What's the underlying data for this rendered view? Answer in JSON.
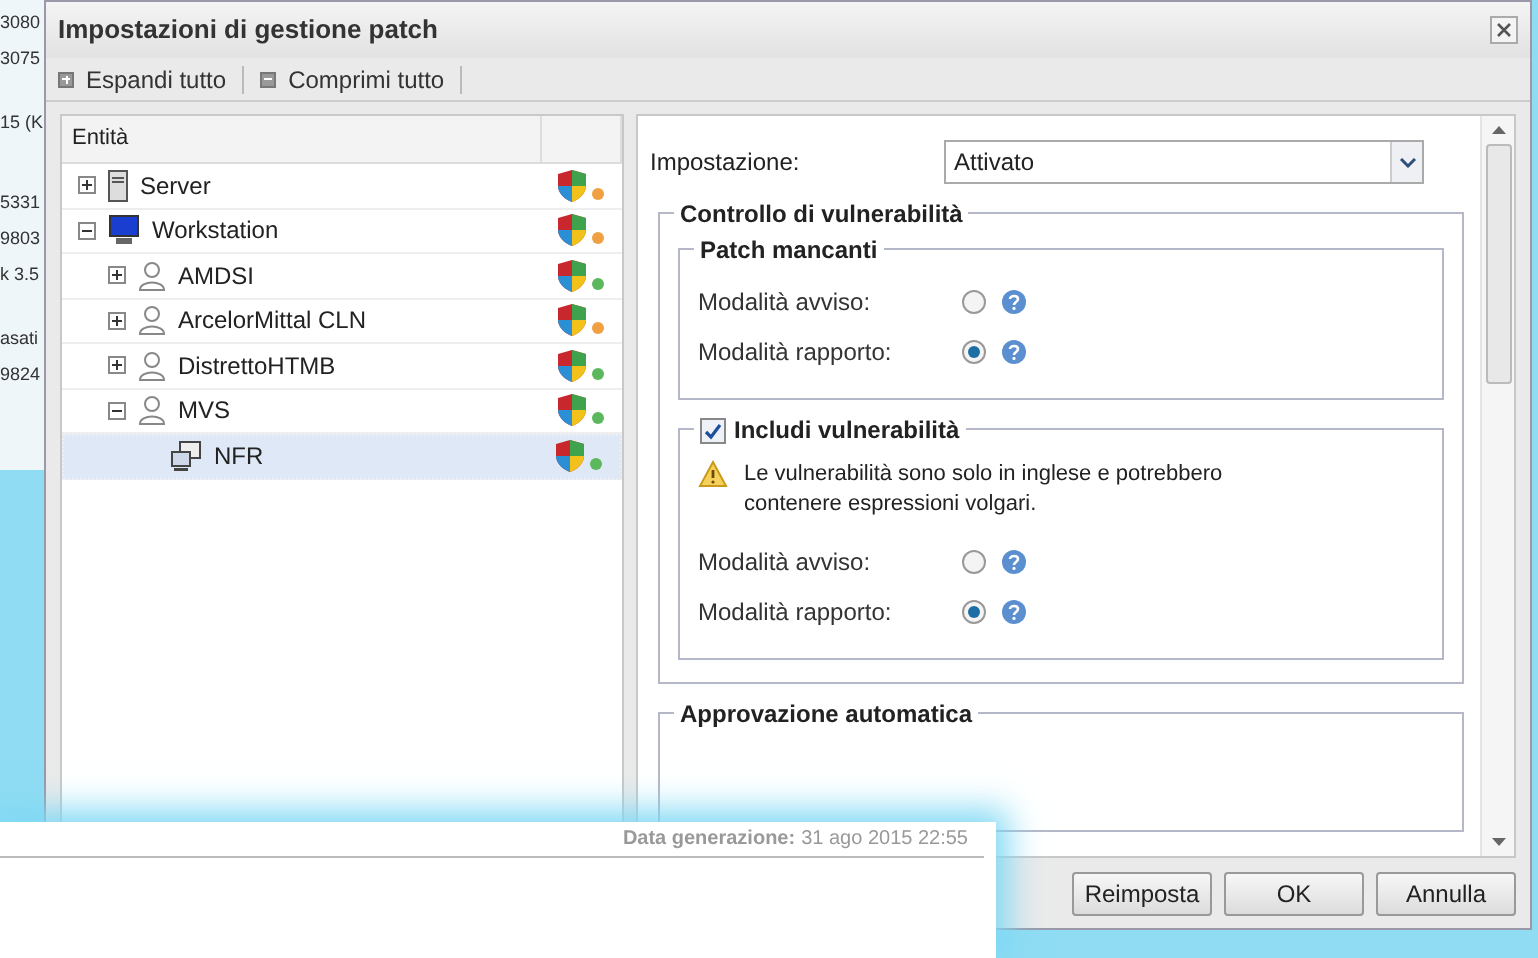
{
  "background_page": {
    "fragments": [
      "3080",
      "3075",
      "15 (K",
      "5331",
      "9803",
      "k 3.5",
      "asati",
      "9824"
    ]
  },
  "window": {
    "title": "Impostazioni di gestione patch"
  },
  "toolbar": [
    {
      "kind": "expand",
      "label": "Espandi tutto"
    },
    {
      "kind": "collapse",
      "label": "Comprimi tutto"
    }
  ],
  "tree": {
    "column": "Entità",
    "items": [
      {
        "label": "Server",
        "kind": "server",
        "expanded": false,
        "selected": false,
        "color": "#f0a040"
      },
      {
        "label": "Workstation",
        "kind": "workstation",
        "expanded": true,
        "selected": false,
        "color": "#f0a040",
        "children": [
          {
            "label": "AMDSI",
            "kind": "user",
            "expanded": false,
            "selected": false,
            "color": "#5cb85c"
          },
          {
            "label": "ArcelorMittal CLN",
            "kind": "user",
            "expanded": false,
            "selected": false,
            "color": "#f0a040"
          },
          {
            "label": "DistrettoHTMB",
            "kind": "user",
            "expanded": false,
            "selected": false,
            "color": "#5cb85c"
          },
          {
            "label": "MVS",
            "kind": "user",
            "expanded": true,
            "selected": false,
            "color": "#5cb85c",
            "children": [
              {
                "label": "NFR",
                "kind": "computer",
                "selected": true,
                "color": "#5cb85c"
              }
            ]
          }
        ]
      }
    ]
  },
  "settings": {
    "label": "Impostazione:",
    "value": "Attivato",
    "groups": [
      {
        "title": "Controllo di vulnerabilità",
        "subgroups": [
          {
            "title": "Patch mancanti",
            "rows": [
              {
                "label": "Modalità avviso:",
                "selected": false
              },
              {
                "label": "Modalità rapporto:",
                "selected": true
              }
            ]
          },
          {
            "title": "Includi vulnerabilità",
            "checked": true,
            "warning": "Le vulnerabilità sono solo in inglese e potrebbero contenere espressioni volgari.",
            "rows": [
              {
                "label": "Modalità avviso:",
                "selected": false
              },
              {
                "label": "Modalità rapporto:",
                "selected": true
              }
            ]
          }
        ]
      },
      {
        "title": "Approvazione automatica"
      }
    ]
  },
  "buttons": [
    "Reimposta",
    "OK",
    "Annulla"
  ],
  "report_overlay": {
    "label": "Data generazione:",
    "value": "31 ago 2015 22:55"
  }
}
